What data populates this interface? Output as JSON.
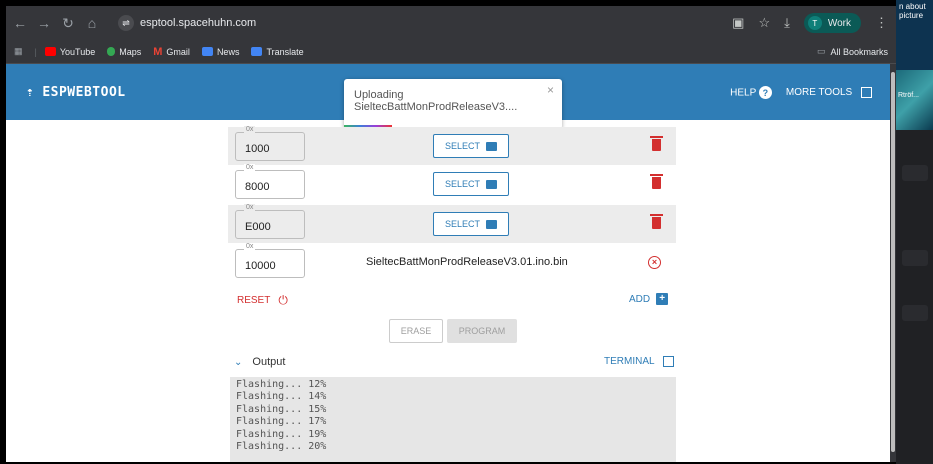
{
  "browser": {
    "url": "esptool.spacehuhn.com",
    "profile_initial": "T",
    "profile_name": "Work",
    "bookmarks": [
      "YouTube",
      "Maps",
      "Gmail",
      "News",
      "Translate"
    ],
    "all_bookmarks": "All Bookmarks"
  },
  "app": {
    "brand": "ESPWEBTOOL",
    "help": "HELP",
    "more_tools": "MORE TOOLS",
    "accent": "#2f7db6"
  },
  "toast": {
    "line1": "Uploading",
    "line2": "SieltecBattMonProdReleaseV3....",
    "close": "×"
  },
  "rows": [
    {
      "prefix": "0x",
      "offset": "1000",
      "button": "SELECT"
    },
    {
      "prefix": "0x",
      "offset": "8000",
      "button": "SELECT"
    },
    {
      "prefix": "0x",
      "offset": "E000",
      "button": "SELECT"
    },
    {
      "prefix": "0x",
      "offset": "10000",
      "file": "SieltecBattMonProdReleaseV3.01.ino.bin"
    }
  ],
  "actions": {
    "reset": "RESET",
    "add": "ADD",
    "erase": "ERASE",
    "program": "PROGRAM"
  },
  "output": {
    "title": "Output",
    "terminal": "TERMINAL",
    "lines": [
      "Flashing... 12%",
      "Flashing... 14%",
      "Flashing... 15%",
      "Flashing... 17%",
      "Flashing... 19%",
      "Flashing... 20%"
    ]
  },
  "desktop_side": {
    "text": "n about\npicture",
    "label": "Rtröf..."
  }
}
